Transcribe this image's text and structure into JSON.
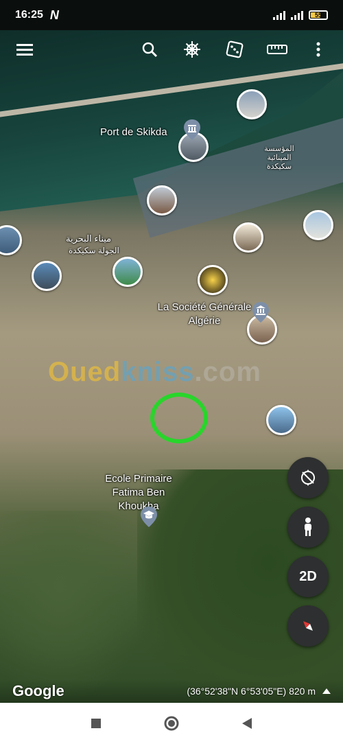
{
  "status": {
    "time": "16:25",
    "notification": "N",
    "battery": "55"
  },
  "toolbar": {
    "menu_icon": "hamburger-menu-icon",
    "search_icon": "search-icon",
    "voyager_icon": "ship-wheel-icon",
    "feeling_lucky_icon": "dice-icon",
    "measure_icon": "ruler-icon",
    "more_icon": "more-vertical-icon"
  },
  "map": {
    "labels": {
      "port": "Port de Skikda",
      "port_arabic": "ميناء البحرية",
      "port_arabic2": "الجولة سكيكدة",
      "company_arabic": "المؤسسة المينائية سكيكدة",
      "bank": "La Société Générale Algérie",
      "school": "Ecole Primaire Fatima Ben Khoukha"
    },
    "watermark_a": "Oued",
    "watermark_b": "kniss",
    "watermark_c": ".com"
  },
  "controls": {
    "reset_tilt_icon": "compass-reset-icon",
    "street_view_icon": "pegman-icon",
    "view_mode": "2D",
    "north_icon": "north-compass-icon"
  },
  "attribution": {
    "logo": "Google",
    "coords": "(36°52'38\"N 6°53'05\"E) 820 m"
  },
  "nav": {
    "recents_icon": "square-icon",
    "home_icon": "circle-icon",
    "back_icon": "triangle-back-icon"
  },
  "colors": {
    "target_ring": "#29d52b",
    "fab_bg": "#2d2f30",
    "compass_red": "#e53935"
  }
}
